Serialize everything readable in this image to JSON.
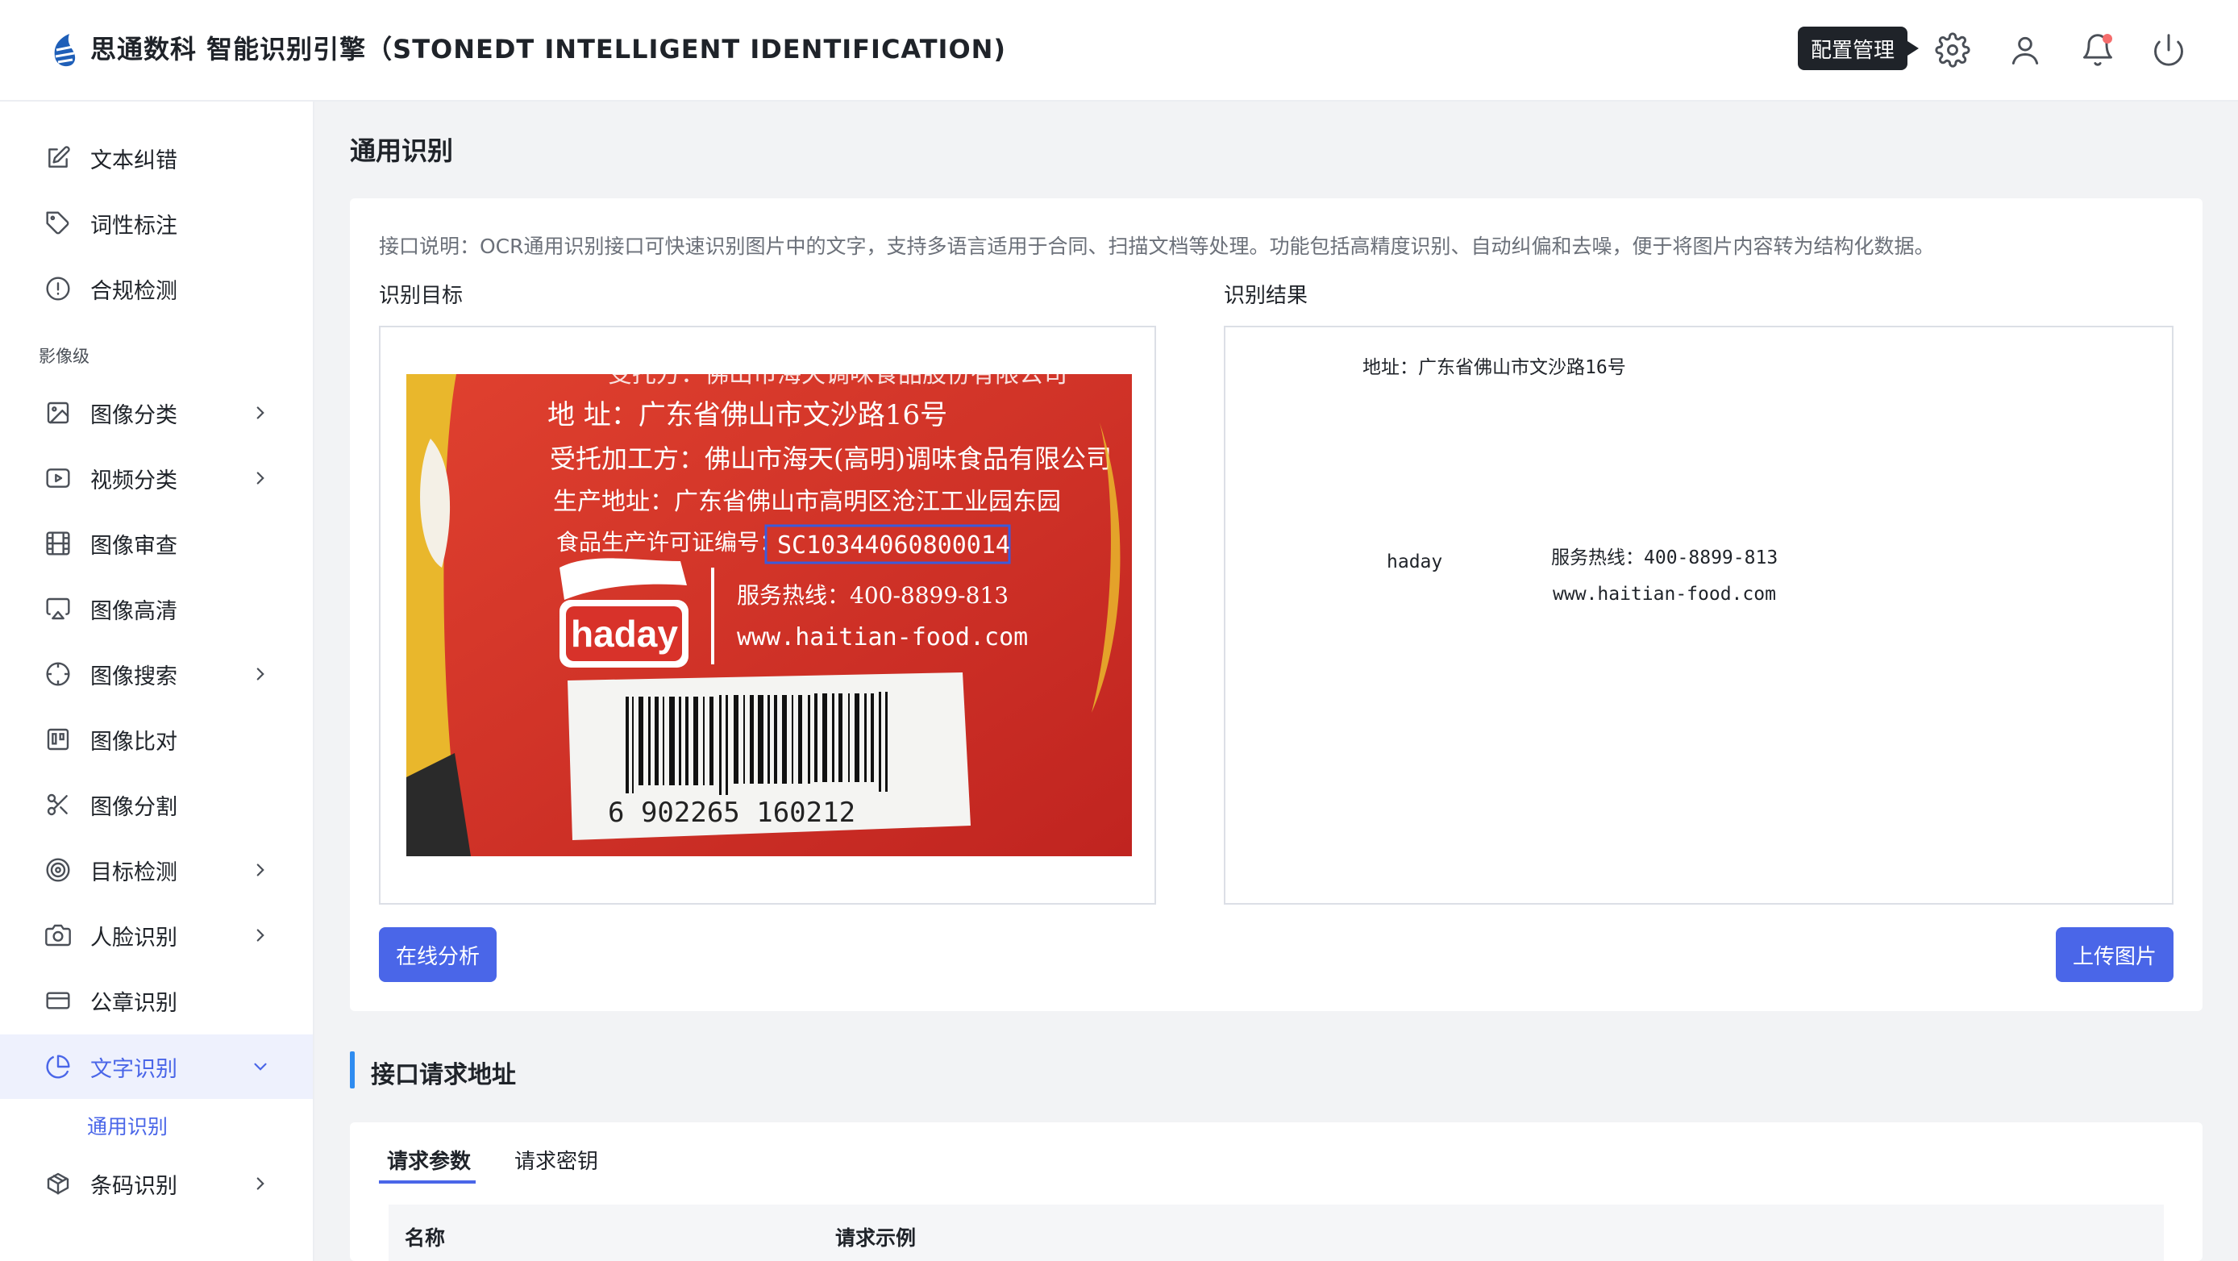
{
  "header": {
    "title": "思通数科 智能识别引擎（STONEDT INTELLIGENT IDENTIFICATION)",
    "tooltip": "配置管理",
    "icons": [
      "gear-icon",
      "user-icon",
      "bell-icon",
      "power-icon"
    ]
  },
  "sidebar": {
    "items_top": [
      {
        "label": "文本纠错",
        "icon": "edit-icon"
      },
      {
        "label": "词性标注",
        "icon": "tag-icon"
      },
      {
        "label": "合规检测",
        "icon": "alert-circle-icon"
      }
    ],
    "section_label": "影像级",
    "items": [
      {
        "label": "图像分类",
        "icon": "image-icon",
        "expandable": true
      },
      {
        "label": "视频分类",
        "icon": "video-icon",
        "expandable": true
      },
      {
        "label": "图像审查",
        "icon": "film-icon",
        "expandable": false
      },
      {
        "label": "图像高清",
        "icon": "airplay-icon",
        "expandable": false
      },
      {
        "label": "图像搜索",
        "icon": "crosshair-icon",
        "expandable": true
      },
      {
        "label": "图像比对",
        "icon": "compare-icon",
        "expandable": false
      },
      {
        "label": "图像分割",
        "icon": "scissors-icon",
        "expandable": false
      },
      {
        "label": "目标检测",
        "icon": "target-icon",
        "expandable": true
      },
      {
        "label": "人脸识别",
        "icon": "camera-icon",
        "expandable": true
      },
      {
        "label": "公章识别",
        "icon": "card-icon",
        "expandable": false
      },
      {
        "label": "文字识别",
        "icon": "pie-chart-icon",
        "expandable": true,
        "active": true
      },
      {
        "label": "条码识别",
        "icon": "box-icon",
        "expandable": true
      }
    ],
    "sub_item": "通用识别"
  },
  "main": {
    "page_title": "通用识别",
    "api_desc": "接口说明：OCR通用识别接口可快速识别图片中的文字，支持多语言适用于合同、扫描文档等处理。功能包括高精度识别、自动纠偏和去噪，便于将图片内容转为结构化数据。",
    "target_label": "识别目标",
    "result_label": "识别结果",
    "photo": {
      "lines": [
        "地 址：广东省佛山市文沙路16号",
        "受托加工方：佛山市海天(高明)调味食品有限公司",
        "生产地址：广东省佛山市高明区沧江工业园东园",
        "食品生产许可证编号：",
        "SC10344060800014",
        "服务热线：400-8899-813",
        "www.haitian-food.com",
        "haday",
        "6 902265 160212"
      ]
    },
    "ocr_result": {
      "address": "地址：广东省佛山市文沙路16号",
      "brand": "haday",
      "hotline": "服务热线：400-8899-813",
      "website": "www.haitian-food.com"
    },
    "analyze_button": "在线分析",
    "upload_button": "上传图片",
    "section_title": "接口请求地址",
    "tabs": [
      "请求参数",
      "请求密钥"
    ],
    "table_headers": [
      "名称",
      "请求示例"
    ]
  },
  "colors": {
    "accent": "#4a66e8",
    "section_bar": "#2f8cf0",
    "photo_red": "#d8322a"
  }
}
